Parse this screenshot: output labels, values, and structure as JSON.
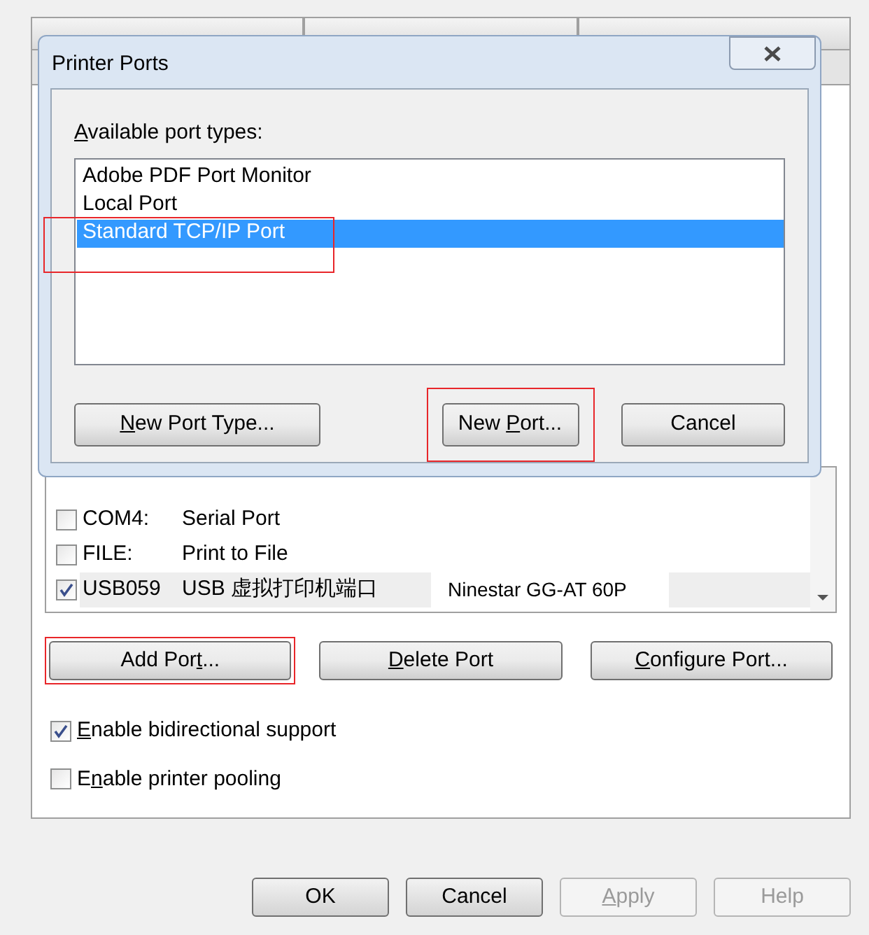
{
  "background_window": {
    "ports": [
      {
        "port": "COM4:",
        "description": "Serial Port",
        "checked": false,
        "selected": false
      },
      {
        "port": "FILE:",
        "description": "Print to File",
        "checked": false,
        "selected": false
      },
      {
        "port": "USB059",
        "description": "USB 虚拟打印机端口",
        "printer": "Ninestar GG-AT 60P",
        "checked": true,
        "selected": true
      }
    ],
    "port_buttons": [
      {
        "text_before": "Add Por",
        "underlined": "t",
        "text_after": "...",
        "highlighted": true
      },
      {
        "underlined": "D",
        "text_after": "elete Port",
        "highlighted": false
      },
      {
        "underlined": "C",
        "text_after": "onfigure Port...",
        "highlighted": false
      }
    ],
    "options": [
      {
        "underlined": "E",
        "text_after": "nable bidirectional support",
        "checked": true
      },
      {
        "text_before": "E",
        "underlined": "n",
        "text_after": "able printer pooling",
        "checked": false
      }
    ],
    "buttons": [
      {
        "text_after": "OK",
        "disabled": false
      },
      {
        "text_after": "Cancel",
        "disabled": false
      },
      {
        "underlined": "A",
        "text_after": "pply",
        "disabled": true
      },
      {
        "text_after": "Help",
        "disabled": true
      }
    ]
  },
  "dialog": {
    "title": "Printer Ports",
    "label": {
      "underlined": "A",
      "text_after": "vailable port types:"
    },
    "port_types": [
      {
        "label": "Adobe PDF Port Monitor",
        "selected": false,
        "highlighted": false
      },
      {
        "label": "Local Port",
        "selected": false,
        "highlighted": false
      },
      {
        "label": "Standard TCP/IP Port",
        "selected": true,
        "highlighted": true
      }
    ],
    "buttons": [
      {
        "underlined": "N",
        "text_after": "ew Port Type...",
        "highlighted": false
      },
      {
        "text_before": "New ",
        "underlined": "P",
        "text_after": "ort...",
        "highlighted": true
      },
      {
        "text_after": "Cancel",
        "highlighted": false
      }
    ]
  }
}
